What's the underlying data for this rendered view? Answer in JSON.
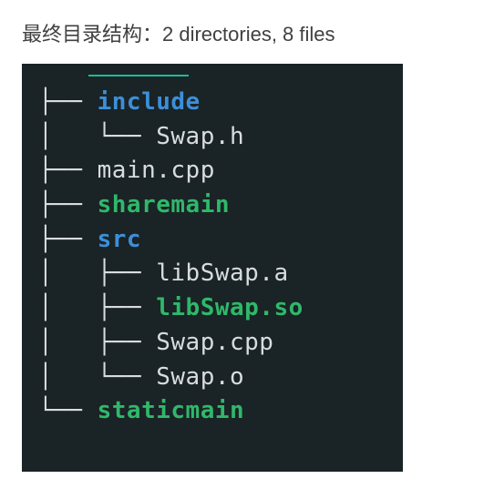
{
  "heading": "最终目录结构：2 directories, 8 files",
  "tree": {
    "root_branch": ".",
    "lines": [
      {
        "prefix": "├── ",
        "name": "include",
        "cls": "dir-blue"
      },
      {
        "prefix": "│   └── ",
        "name": "Swap.h",
        "cls": "file-plain"
      },
      {
        "prefix": "├── ",
        "name": "main.cpp",
        "cls": "file-plain"
      },
      {
        "prefix": "├── ",
        "name": "sharemain",
        "cls": "exec-green"
      },
      {
        "prefix": "├── ",
        "name": "src",
        "cls": "dir-blue"
      },
      {
        "prefix": "│   ├── ",
        "name": "libSwap.a",
        "cls": "file-plain"
      },
      {
        "prefix": "│   ├── ",
        "name": "libSwap.so",
        "cls": "exec-green"
      },
      {
        "prefix": "│   ├── ",
        "name": "Swap.cpp",
        "cls": "file-plain"
      },
      {
        "prefix": "│   └── ",
        "name": "Swap.o",
        "cls": "file-plain"
      },
      {
        "prefix": "└── ",
        "name": "staticmain",
        "cls": "exec-green"
      }
    ]
  }
}
